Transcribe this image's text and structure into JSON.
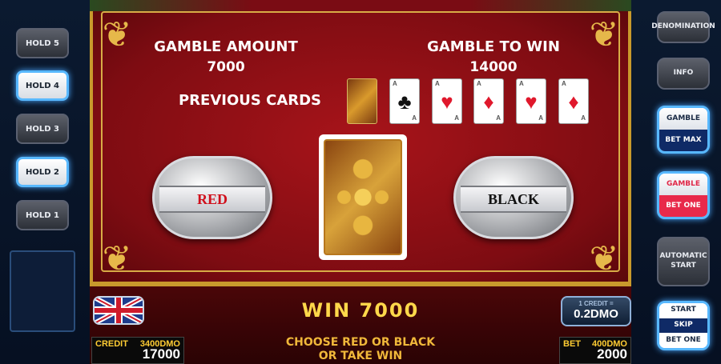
{
  "left_panel": {
    "holds": [
      {
        "label": "HOLD 5",
        "lit": false
      },
      {
        "label": "HOLD 4",
        "lit": true
      },
      {
        "label": "HOLD 3",
        "lit": false
      },
      {
        "label": "HOLD 2",
        "lit": true
      },
      {
        "label": "HOLD 1",
        "lit": false
      }
    ]
  },
  "right_panel": {
    "denomination": "DENOMINATION",
    "info": "INFO",
    "gamble_top": "GAMBLE",
    "gamble_bottom": "BET MAX",
    "gamble2_top": "GAMBLE",
    "gamble2_bottom": "BET ONE",
    "automatic_start": "AUTOMATIC START",
    "start": "START",
    "skip": "SKIP",
    "bet_one": "BET ONE"
  },
  "gamble": {
    "amount_label": "GAMBLE AMOUNT",
    "amount_value": "7000",
    "to_win_label": "GAMBLE TO WIN",
    "to_win_value": "14000",
    "previous_label": "PREVIOUS CARDS",
    "previous_cards": [
      {
        "type": "back"
      },
      {
        "rank": "A",
        "suit": "♣",
        "color": "#111111"
      },
      {
        "rank": "A",
        "suit": "♥",
        "color": "#e0182c"
      },
      {
        "rank": "A",
        "suit": "♦",
        "color": "#e0182c"
      },
      {
        "rank": "A",
        "suit": "♥",
        "color": "#e0182c"
      },
      {
        "rank": "A",
        "suit": "♦",
        "color": "#e0182c"
      }
    ],
    "red_label": "RED",
    "black_label": "BLACK"
  },
  "bottom": {
    "win_text": "WIN 7000",
    "message_line1": "CHOOSE RED OR BLACK",
    "message_line2": "OR TAKE WIN",
    "credit_label": "CREDIT",
    "credit_sub": "3400DMO",
    "credit_value": "17000",
    "bet_label": "BET",
    "bet_sub": "400DMO",
    "bet_value": "2000",
    "denom_label": "1 CREDIT =",
    "denom_value": "0.2DMO"
  },
  "colors": {
    "table_red": "#a8141a",
    "gold": "#c99a2c",
    "win_yellow": "#ffd84a",
    "highlight_blue": "#58b8ff"
  }
}
